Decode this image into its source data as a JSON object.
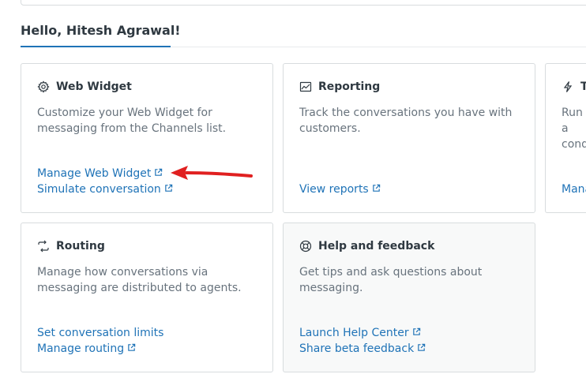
{
  "greeting": "Hello, Hitesh Agrawal!",
  "cards": [
    {
      "title": "Web Widget",
      "icon": "gear-icon",
      "description": "Customize your Web Widget for messaging from the Channels list.",
      "links": [
        "Manage Web Widget",
        "Simulate conversation"
      ]
    },
    {
      "title": "Reporting",
      "icon": "chart-icon",
      "description": "Track the conversations you have with customers.",
      "links": [
        "View reports"
      ]
    },
    {
      "title": "T",
      "icon": "lightning-icon",
      "description_lines": [
        "Run a",
        "cond"
      ],
      "links": [
        "Mana"
      ]
    },
    {
      "title": "Routing",
      "icon": "routing-icon",
      "description": "Manage how conversations via messaging are distributed to agents.",
      "links": [
        "Set conversation limits",
        "Manage routing"
      ]
    },
    {
      "title": "Help and feedback",
      "icon": "lifebuoy-icon",
      "description": "Get tips and ask questions about messaging.",
      "links": [
        "Launch Help Center",
        "Share beta feedback"
      ]
    }
  ],
  "colors": {
    "link": "#1f73b7",
    "annotation_arrow": "#e02020",
    "tinted_card": "#f8f9f9"
  }
}
